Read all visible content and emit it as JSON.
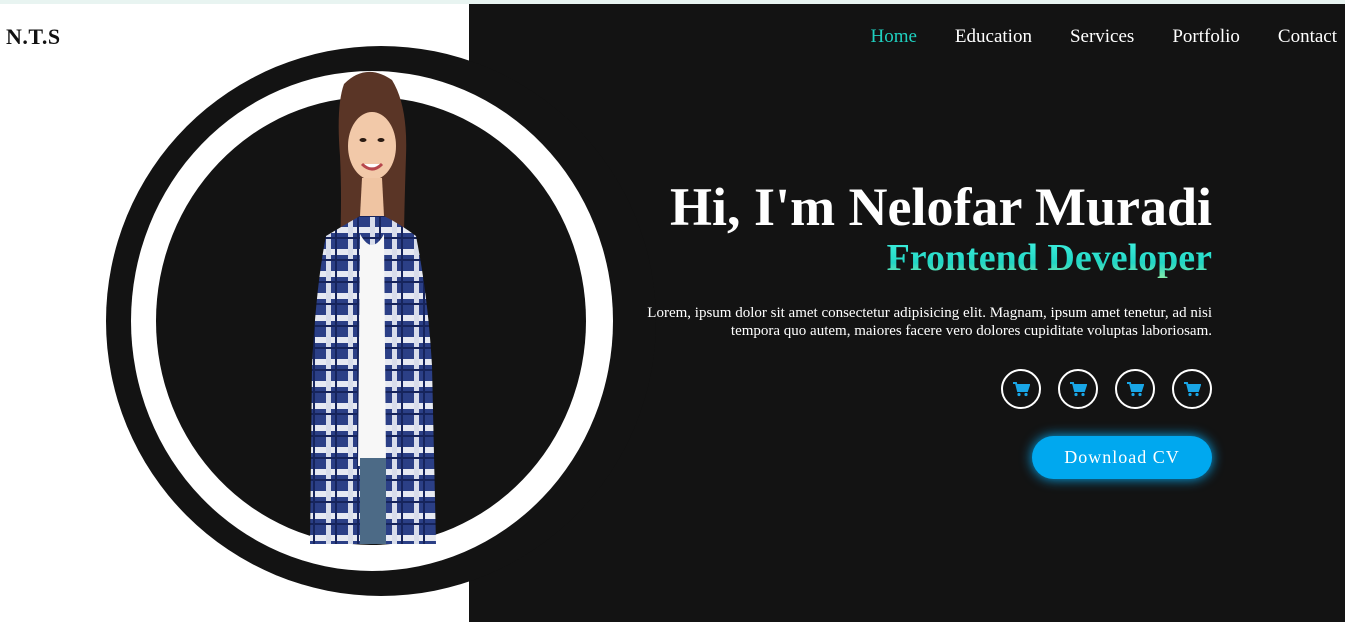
{
  "header": {
    "logo": "N.T.S",
    "nav": [
      {
        "label": "Home",
        "active": true
      },
      {
        "label": "Education",
        "active": false
      },
      {
        "label": "Services",
        "active": false
      },
      {
        "label": "Portfolio",
        "active": false
      },
      {
        "label": "Contact",
        "active": false
      }
    ]
  },
  "hero": {
    "greeting": "Hi, I'm Nelofar Muradi",
    "role": "Frontend Developer",
    "description": "Lorem, ipsum dolor sit amet consectetur adipisicing elit. Magnam, ipsum amet tenetur, ad nisi tempora quo autem, maiores facere vero dolores cupiditate voluptas laboriosam.",
    "social_icons": [
      "cart-icon",
      "cart-icon",
      "cart-icon",
      "cart-icon"
    ],
    "download_label": "Download CV"
  },
  "colors": {
    "accent": "#1fd0c0",
    "button": "#00a8ef",
    "dark": "#131313"
  }
}
